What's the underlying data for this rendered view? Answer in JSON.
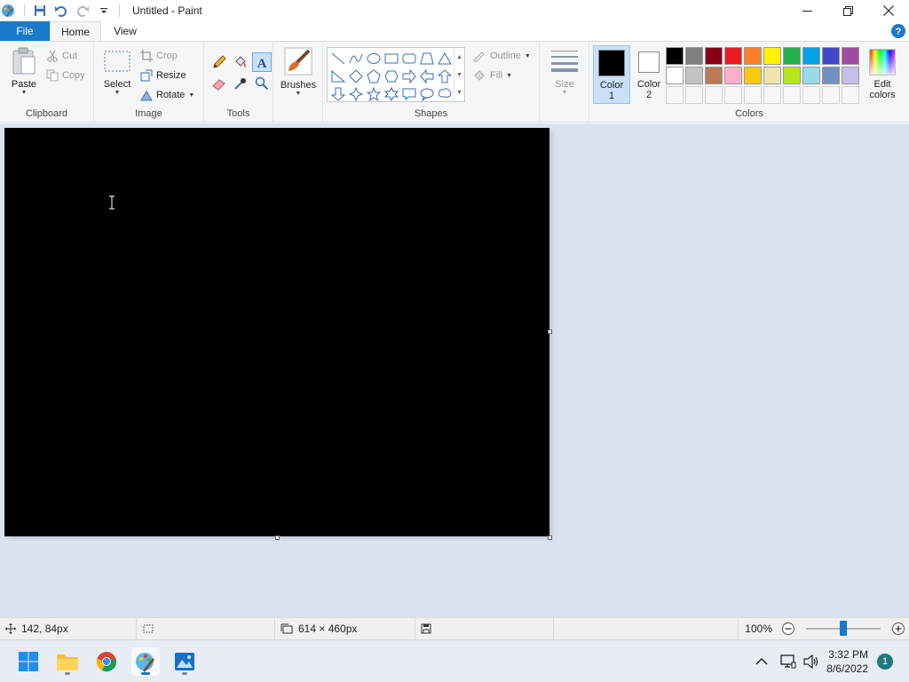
{
  "window": {
    "title": "Untitled - Paint"
  },
  "tabs": {
    "file": "File",
    "home": "Home",
    "view": "View"
  },
  "ribbon": {
    "clipboard": {
      "label": "Clipboard",
      "paste": "Paste",
      "cut": "Cut",
      "copy": "Copy"
    },
    "image": {
      "label": "Image",
      "select": "Select",
      "crop": "Crop",
      "resize": "Resize",
      "rotate": "Rotate"
    },
    "tools": {
      "label": "Tools"
    },
    "brushes": {
      "label": "Brushes"
    },
    "shapes": {
      "label": "Shapes",
      "outline": "Outline",
      "fill": "Fill"
    },
    "size": {
      "label": "Size"
    },
    "colors": {
      "label": "Colors",
      "color1_line1": "Color",
      "color1_line2": "1",
      "color2_line1": "Color",
      "color2_line2": "2",
      "edit_line1": "Edit",
      "edit_line2": "colors",
      "color1_value": "#000000",
      "color2_value": "#ffffff",
      "palette_row1": [
        "#000000",
        "#7f7f7f",
        "#880015",
        "#ed1c24",
        "#ff7f27",
        "#fff200",
        "#22b14c",
        "#00a2e8",
        "#3f48cc",
        "#a349a4"
      ],
      "palette_row2": [
        "#ffffff",
        "#c3c3c3",
        "#b97a57",
        "#ffaec9",
        "#ffc90e",
        "#efe4b0",
        "#b5e61d",
        "#99d9ea",
        "#7092be",
        "#c8bfe7"
      ]
    }
  },
  "canvas": {
    "fill_color": "#000000"
  },
  "status": {
    "cursor_position": "142, 84px",
    "canvas_size": "614 × 460px",
    "zoom": "100%"
  },
  "taskbar": {
    "time": "3:32 PM",
    "date": "8/6/2022",
    "notification_count": "1"
  }
}
